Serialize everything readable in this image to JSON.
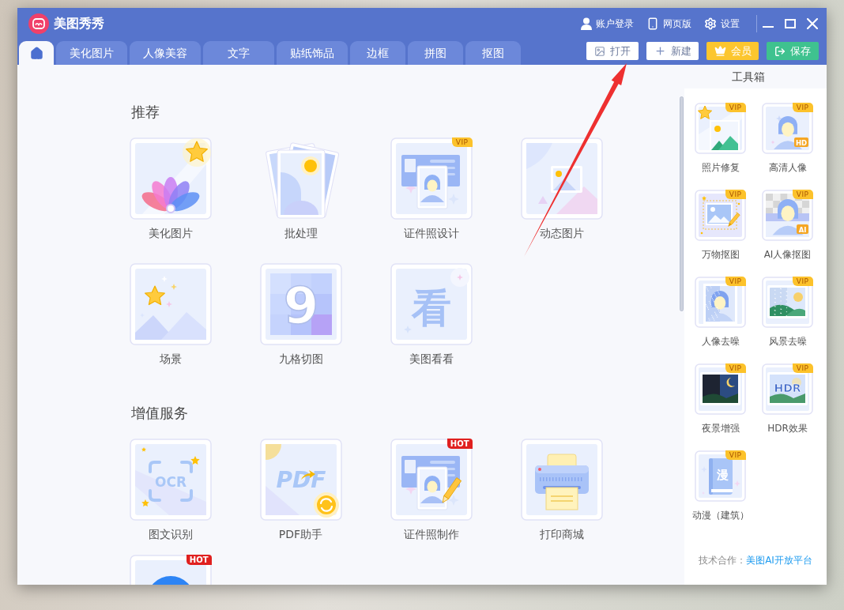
{
  "window": {
    "title": "美图秀秀"
  },
  "header_links": [
    {
      "kind": "account",
      "label": "账户登录"
    },
    {
      "kind": "web",
      "label": "网页版"
    },
    {
      "kind": "settings",
      "label": "设置"
    }
  ],
  "tabs": [
    {
      "kind": "home",
      "selected": true
    },
    {
      "kind": "text",
      "label": "美化图片",
      "selected": false
    },
    {
      "kind": "text",
      "label": "人像美容",
      "selected": false
    },
    {
      "kind": "text",
      "label": "文字",
      "selected": false
    },
    {
      "kind": "text",
      "label": "贴纸饰品",
      "selected": false
    },
    {
      "kind": "text",
      "label": "边框",
      "selected": false
    },
    {
      "kind": "text",
      "label": "拼图",
      "selected": false
    },
    {
      "kind": "text",
      "label": "抠图",
      "selected": false
    }
  ],
  "actions": [
    {
      "kind": "open",
      "label": "打开"
    },
    {
      "kind": "new",
      "label": "新建"
    },
    {
      "kind": "vip",
      "label": "会员"
    },
    {
      "kind": "save",
      "label": "保存"
    }
  ],
  "sections": [
    {
      "title": "推荐",
      "items": [
        {
          "kind": "beautify",
          "label": "美化图片"
        },
        {
          "kind": "batch",
          "label": "批处理"
        },
        {
          "kind": "id_design",
          "label": "证件照设计",
          "badge": {
            "kind": "vip",
            "text": "VIP"
          }
        },
        {
          "kind": "dynamic",
          "label": "动态图片"
        },
        {
          "kind": "scene",
          "label": "场景"
        },
        {
          "kind": "nine_grid",
          "label": "九格切图",
          "glyph": "9"
        },
        {
          "kind": "look",
          "label": "美图看看",
          "glyph": "看"
        }
      ]
    },
    {
      "title": "增值服务",
      "items": [
        {
          "kind": "ocr",
          "label": "图文识别",
          "glyph": "OCR"
        },
        {
          "kind": "pdf",
          "label": "PDF助手",
          "glyph": "PDF"
        },
        {
          "kind": "id_make",
          "label": "证件照制作",
          "badge": {
            "kind": "hot",
            "text": "HOT"
          }
        },
        {
          "kind": "print",
          "label": "打印商城"
        },
        {
          "kind": "circle",
          "badge": {
            "kind": "hot",
            "text": "HOT"
          }
        }
      ]
    }
  ],
  "toolbox": {
    "title": "工具箱",
    "tools": [
      {
        "kind": "repair",
        "label": "照片修复",
        "badge": {
          "kind": "vip",
          "text": "VIP"
        }
      },
      {
        "kind": "hd",
        "label": "高清人像",
        "glyph": "HD",
        "badge": {
          "kind": "vip",
          "text": "VIP"
        }
      },
      {
        "kind": "cutout",
        "label": "万物抠图",
        "badge": {
          "kind": "vip",
          "text": "VIP"
        }
      },
      {
        "kind": "ai_cutout",
        "label": "AI人像抠图",
        "glyph": "AI",
        "badge": {
          "kind": "vip",
          "text": "VIP"
        }
      },
      {
        "kind": "portrait_denoise",
        "label": "人像去噪",
        "badge": {
          "kind": "vip",
          "text": "VIP"
        }
      },
      {
        "kind": "landscape_denoise",
        "label": "风景去噪",
        "badge": {
          "kind": "vip",
          "text": "VIP"
        }
      },
      {
        "kind": "night",
        "label": "夜景增强",
        "badge": {
          "kind": "vip",
          "text": "VIP"
        }
      },
      {
        "kind": "hdr",
        "label": "HDR效果",
        "glyph": "HDR",
        "badge": {
          "kind": "vip",
          "text": "VIP"
        }
      },
      {
        "kind": "anime",
        "label": "动漫（建筑）",
        "glyph": "漫",
        "badge": {
          "kind": "vip",
          "text": "VIP"
        }
      }
    ],
    "footer": {
      "text": "技术合作：",
      "link": "美图AI开放平台"
    }
  }
}
